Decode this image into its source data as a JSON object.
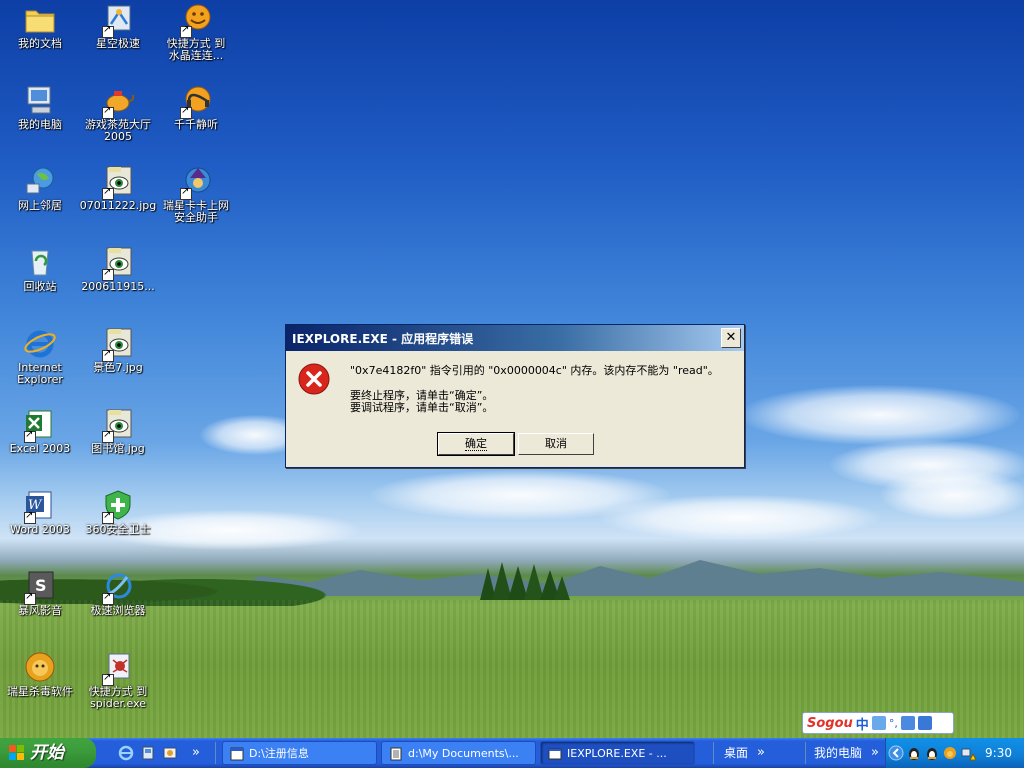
{
  "desktop_icons": [
    {
      "label": "我的文档"
    },
    {
      "label": "星空极速"
    },
    {
      "label": "快捷方式 到\n水晶连连..."
    },
    {
      "label": "我的电脑"
    },
    {
      "label": "游戏茶苑大厅\n2005"
    },
    {
      "label": "千千静听"
    },
    {
      "label": "网上邻居"
    },
    {
      "label": "07011222.jpg"
    },
    {
      "label": "瑞星卡卡上网\n安全助手"
    },
    {
      "label": "回收站"
    },
    {
      "label": "200611915..."
    },
    {
      "label": "Internet\nExplorer"
    },
    {
      "label": "景色7.jpg"
    },
    {
      "label": "Excel 2003"
    },
    {
      "label": "图书馆.jpg"
    },
    {
      "label": "Word 2003"
    },
    {
      "label": "360安全卫士"
    },
    {
      "label": "暴风影音"
    },
    {
      "label": "极速浏览器"
    },
    {
      "label": "瑞星杀毒软件"
    },
    {
      "label": "快捷方式 到\nspider.exe"
    }
  ],
  "dialog": {
    "title": "IEXPLORE.EXE - 应用程序错误",
    "message": "\"0x7e4182f0\" 指令引用的 \"0x0000004c\" 内存。该内存不能为 \"read\"。",
    "hint_terminate": "要终止程序，请单击“确定”。",
    "hint_debug": "要调试程序，请单击“取消”。",
    "ok_label": "确定",
    "cancel_label": "取消",
    "close_glyph": "✕"
  },
  "sogou": {
    "logo": "Sogou",
    "mode": "中",
    "punct": "°,"
  },
  "taskbar": {
    "start_label": "开始",
    "more_glyph": "»",
    "tasks": [
      {
        "label": "D:\\注册信息"
      },
      {
        "label": "d:\\My Documents\\..."
      },
      {
        "label": "IEXPLORE.EXE - ..."
      }
    ],
    "toolbar_desktop": "桌面",
    "toolbar_mycomputer": "我的电脑",
    "clock": "9:30"
  },
  "colors": {
    "taskbar_blue": "#245edb",
    "start_green": "#3c9c3c",
    "dialog_face": "#ece9d8",
    "error_red": "#d8261c"
  }
}
